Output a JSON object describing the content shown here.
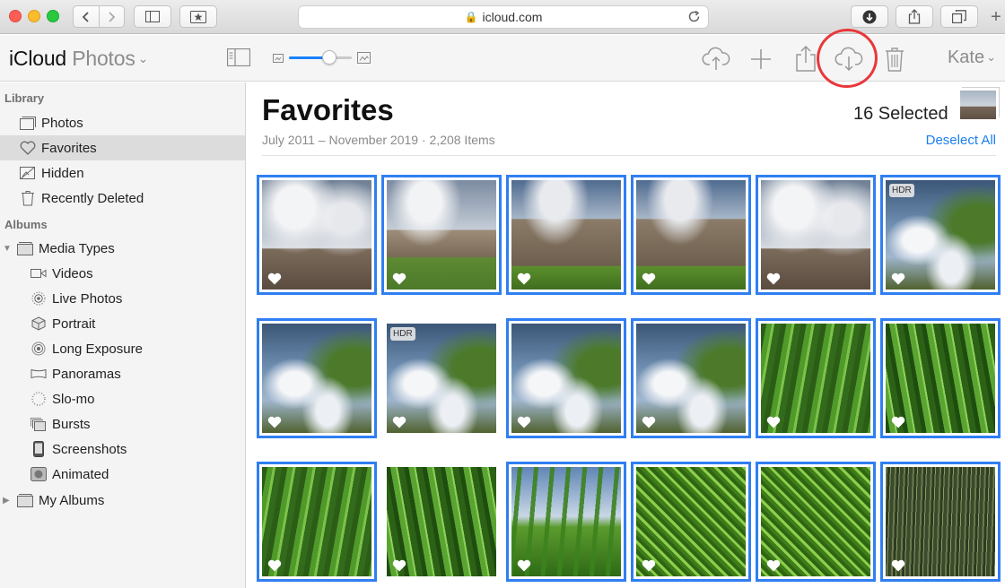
{
  "browser": {
    "url": "icloud.com"
  },
  "app": {
    "title_main": "iCloud",
    "title_sub": "Photos",
    "user": "Kate"
  },
  "sidebar": {
    "library_heading": "Library",
    "library_items": [
      {
        "label": "Photos",
        "icon": "photos-icon"
      },
      {
        "label": "Favorites",
        "icon": "heart-icon",
        "selected": true
      },
      {
        "label": "Hidden",
        "icon": "hidden-icon"
      },
      {
        "label": "Recently Deleted",
        "icon": "trash-icon"
      }
    ],
    "albums_heading": "Albums",
    "media_types_label": "Media Types",
    "media_items": [
      {
        "label": "Videos",
        "icon": "video-icon"
      },
      {
        "label": "Live Photos",
        "icon": "live-photos-icon"
      },
      {
        "label": "Portrait",
        "icon": "portrait-icon"
      },
      {
        "label": "Long Exposure",
        "icon": "long-exposure-icon"
      },
      {
        "label": "Panoramas",
        "icon": "panorama-icon"
      },
      {
        "label": "Slo-mo",
        "icon": "slomo-icon"
      },
      {
        "label": "Bursts",
        "icon": "bursts-icon"
      },
      {
        "label": "Screenshots",
        "icon": "screenshot-icon"
      },
      {
        "label": "Animated",
        "icon": "animated-icon"
      }
    ],
    "my_albums_label": "My Albums"
  },
  "content": {
    "title": "Favorites",
    "subtitle": "July 2011 – November 2019  ·  2,208 Items",
    "selected_count": "16 Selected",
    "deselect_label": "Deselect All",
    "hdr_label": "HDR"
  },
  "colors": {
    "accent": "#2f7ff2",
    "annotation": "#e8383a"
  }
}
